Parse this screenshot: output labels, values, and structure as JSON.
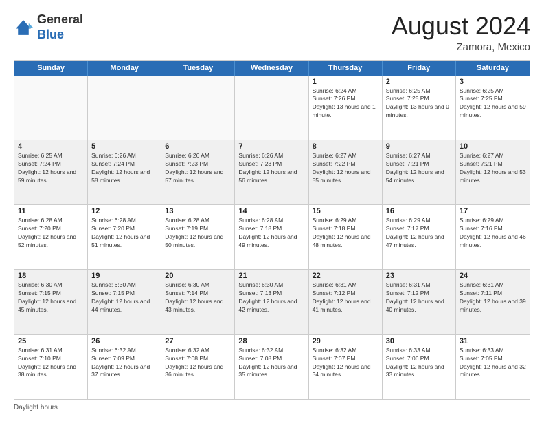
{
  "logo": {
    "general": "General",
    "blue": "Blue"
  },
  "header": {
    "month": "August 2024",
    "location": "Zamora, Mexico"
  },
  "weekdays": [
    "Sunday",
    "Monday",
    "Tuesday",
    "Wednesday",
    "Thursday",
    "Friday",
    "Saturday"
  ],
  "footer": {
    "label": "Daylight hours"
  },
  "rows": [
    [
      {
        "day": "",
        "sunrise": "",
        "sunset": "",
        "daylight": "",
        "empty": true
      },
      {
        "day": "",
        "sunrise": "",
        "sunset": "",
        "daylight": "",
        "empty": true
      },
      {
        "day": "",
        "sunrise": "",
        "sunset": "",
        "daylight": "",
        "empty": true
      },
      {
        "day": "",
        "sunrise": "",
        "sunset": "",
        "daylight": "",
        "empty": true
      },
      {
        "day": "1",
        "sunrise": "Sunrise: 6:24 AM",
        "sunset": "Sunset: 7:26 PM",
        "daylight": "Daylight: 13 hours and 1 minute.",
        "empty": false
      },
      {
        "day": "2",
        "sunrise": "Sunrise: 6:25 AM",
        "sunset": "Sunset: 7:25 PM",
        "daylight": "Daylight: 13 hours and 0 minutes.",
        "empty": false
      },
      {
        "day": "3",
        "sunrise": "Sunrise: 6:25 AM",
        "sunset": "Sunset: 7:25 PM",
        "daylight": "Daylight: 12 hours and 59 minutes.",
        "empty": false
      }
    ],
    [
      {
        "day": "4",
        "sunrise": "Sunrise: 6:25 AM",
        "sunset": "Sunset: 7:24 PM",
        "daylight": "Daylight: 12 hours and 59 minutes.",
        "empty": false
      },
      {
        "day": "5",
        "sunrise": "Sunrise: 6:26 AM",
        "sunset": "Sunset: 7:24 PM",
        "daylight": "Daylight: 12 hours and 58 minutes.",
        "empty": false
      },
      {
        "day": "6",
        "sunrise": "Sunrise: 6:26 AM",
        "sunset": "Sunset: 7:23 PM",
        "daylight": "Daylight: 12 hours and 57 minutes.",
        "empty": false
      },
      {
        "day": "7",
        "sunrise": "Sunrise: 6:26 AM",
        "sunset": "Sunset: 7:23 PM",
        "daylight": "Daylight: 12 hours and 56 minutes.",
        "empty": false
      },
      {
        "day": "8",
        "sunrise": "Sunrise: 6:27 AM",
        "sunset": "Sunset: 7:22 PM",
        "daylight": "Daylight: 12 hours and 55 minutes.",
        "empty": false
      },
      {
        "day": "9",
        "sunrise": "Sunrise: 6:27 AM",
        "sunset": "Sunset: 7:21 PM",
        "daylight": "Daylight: 12 hours and 54 minutes.",
        "empty": false
      },
      {
        "day": "10",
        "sunrise": "Sunrise: 6:27 AM",
        "sunset": "Sunset: 7:21 PM",
        "daylight": "Daylight: 12 hours and 53 minutes.",
        "empty": false
      }
    ],
    [
      {
        "day": "11",
        "sunrise": "Sunrise: 6:28 AM",
        "sunset": "Sunset: 7:20 PM",
        "daylight": "Daylight: 12 hours and 52 minutes.",
        "empty": false
      },
      {
        "day": "12",
        "sunrise": "Sunrise: 6:28 AM",
        "sunset": "Sunset: 7:20 PM",
        "daylight": "Daylight: 12 hours and 51 minutes.",
        "empty": false
      },
      {
        "day": "13",
        "sunrise": "Sunrise: 6:28 AM",
        "sunset": "Sunset: 7:19 PM",
        "daylight": "Daylight: 12 hours and 50 minutes.",
        "empty": false
      },
      {
        "day": "14",
        "sunrise": "Sunrise: 6:28 AM",
        "sunset": "Sunset: 7:18 PM",
        "daylight": "Daylight: 12 hours and 49 minutes.",
        "empty": false
      },
      {
        "day": "15",
        "sunrise": "Sunrise: 6:29 AM",
        "sunset": "Sunset: 7:18 PM",
        "daylight": "Daylight: 12 hours and 48 minutes.",
        "empty": false
      },
      {
        "day": "16",
        "sunrise": "Sunrise: 6:29 AM",
        "sunset": "Sunset: 7:17 PM",
        "daylight": "Daylight: 12 hours and 47 minutes.",
        "empty": false
      },
      {
        "day": "17",
        "sunrise": "Sunrise: 6:29 AM",
        "sunset": "Sunset: 7:16 PM",
        "daylight": "Daylight: 12 hours and 46 minutes.",
        "empty": false
      }
    ],
    [
      {
        "day": "18",
        "sunrise": "Sunrise: 6:30 AM",
        "sunset": "Sunset: 7:15 PM",
        "daylight": "Daylight: 12 hours and 45 minutes.",
        "empty": false
      },
      {
        "day": "19",
        "sunrise": "Sunrise: 6:30 AM",
        "sunset": "Sunset: 7:15 PM",
        "daylight": "Daylight: 12 hours and 44 minutes.",
        "empty": false
      },
      {
        "day": "20",
        "sunrise": "Sunrise: 6:30 AM",
        "sunset": "Sunset: 7:14 PM",
        "daylight": "Daylight: 12 hours and 43 minutes.",
        "empty": false
      },
      {
        "day": "21",
        "sunrise": "Sunrise: 6:30 AM",
        "sunset": "Sunset: 7:13 PM",
        "daylight": "Daylight: 12 hours and 42 minutes.",
        "empty": false
      },
      {
        "day": "22",
        "sunrise": "Sunrise: 6:31 AM",
        "sunset": "Sunset: 7:12 PM",
        "daylight": "Daylight: 12 hours and 41 minutes.",
        "empty": false
      },
      {
        "day": "23",
        "sunrise": "Sunrise: 6:31 AM",
        "sunset": "Sunset: 7:12 PM",
        "daylight": "Daylight: 12 hours and 40 minutes.",
        "empty": false
      },
      {
        "day": "24",
        "sunrise": "Sunrise: 6:31 AM",
        "sunset": "Sunset: 7:11 PM",
        "daylight": "Daylight: 12 hours and 39 minutes.",
        "empty": false
      }
    ],
    [
      {
        "day": "25",
        "sunrise": "Sunrise: 6:31 AM",
        "sunset": "Sunset: 7:10 PM",
        "daylight": "Daylight: 12 hours and 38 minutes.",
        "empty": false
      },
      {
        "day": "26",
        "sunrise": "Sunrise: 6:32 AM",
        "sunset": "Sunset: 7:09 PM",
        "daylight": "Daylight: 12 hours and 37 minutes.",
        "empty": false
      },
      {
        "day": "27",
        "sunrise": "Sunrise: 6:32 AM",
        "sunset": "Sunset: 7:08 PM",
        "daylight": "Daylight: 12 hours and 36 minutes.",
        "empty": false
      },
      {
        "day": "28",
        "sunrise": "Sunrise: 6:32 AM",
        "sunset": "Sunset: 7:08 PM",
        "daylight": "Daylight: 12 hours and 35 minutes.",
        "empty": false
      },
      {
        "day": "29",
        "sunrise": "Sunrise: 6:32 AM",
        "sunset": "Sunset: 7:07 PM",
        "daylight": "Daylight: 12 hours and 34 minutes.",
        "empty": false
      },
      {
        "day": "30",
        "sunrise": "Sunrise: 6:33 AM",
        "sunset": "Sunset: 7:06 PM",
        "daylight": "Daylight: 12 hours and 33 minutes.",
        "empty": false
      },
      {
        "day": "31",
        "sunrise": "Sunrise: 6:33 AM",
        "sunset": "Sunset: 7:05 PM",
        "daylight": "Daylight: 12 hours and 32 minutes.",
        "empty": false
      }
    ]
  ]
}
